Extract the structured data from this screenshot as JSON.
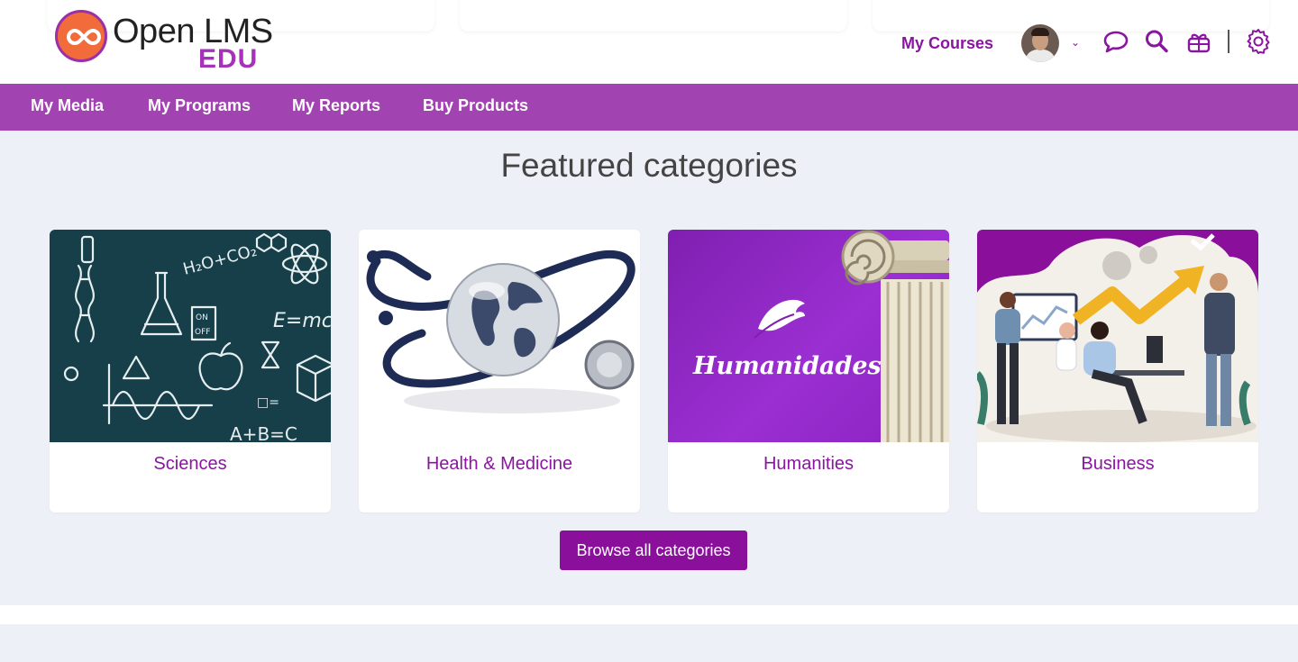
{
  "header": {
    "logo_text": "Open LMS",
    "logo_sub": "EDU",
    "my_courses_label": "My Courses",
    "user_menu_caret": "⌄",
    "icons": [
      "chat-icon",
      "search-icon",
      "gift-icon",
      "gear-icon"
    ]
  },
  "nav": {
    "items": [
      {
        "label": "My Media"
      },
      {
        "label": "My Programs"
      },
      {
        "label": "My Reports"
      },
      {
        "label": "Buy Products"
      }
    ]
  },
  "main": {
    "title": "Featured categories",
    "categories": [
      {
        "label": "Sciences"
      },
      {
        "label": "Health & Medicine"
      },
      {
        "label": "Humanities",
        "image_text": "Humanidades"
      },
      {
        "label": "Business"
      }
    ],
    "browse_label": "Browse all categories"
  },
  "colors": {
    "brand": "#8a15a0",
    "nav_bg": "#a143b0",
    "button_bg": "#8a0f9b",
    "page_bg": "#eef0f7"
  }
}
